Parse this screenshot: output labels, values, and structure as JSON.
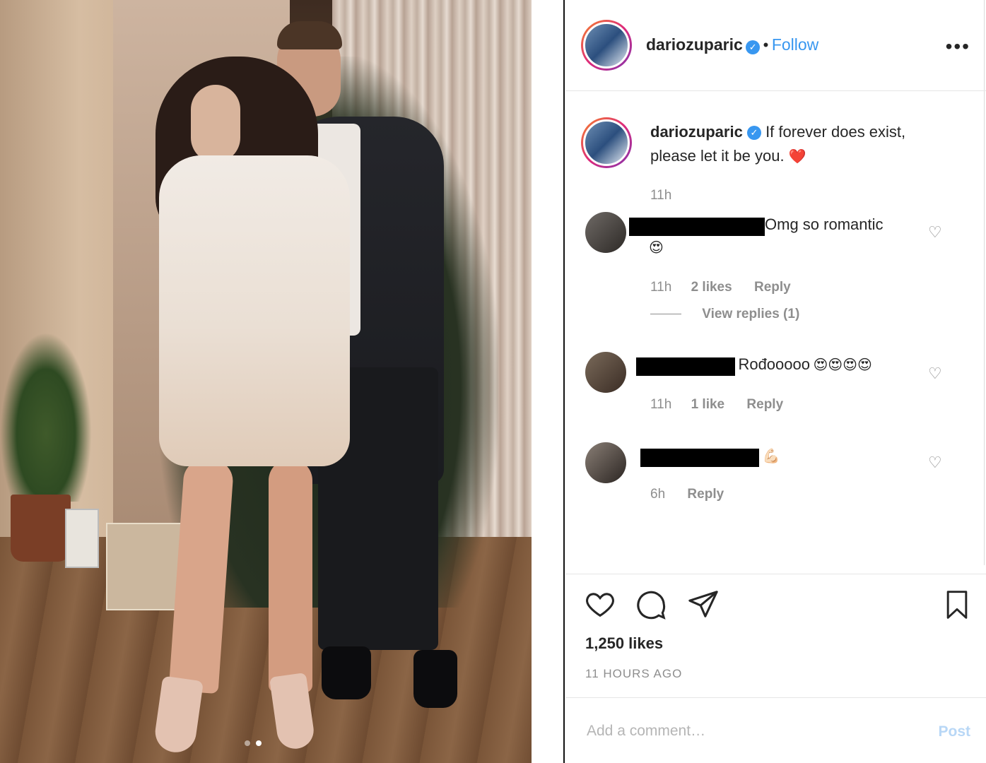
{
  "post": {
    "author": "dariozuparic",
    "follow_label": "Follow",
    "separator": "•",
    "more_label": "•••",
    "caption": "If forever does exist, please let it be you.",
    "caption_emoji": "❤️",
    "caption_time": "11h",
    "carousel": {
      "count": 2,
      "active": 2
    }
  },
  "comments": [
    {
      "text": "Omg so romantic",
      "emoji": "😍",
      "time": "11h",
      "likes": "2 likes",
      "reply_label": "Reply",
      "view_replies": "View replies (1)"
    },
    {
      "text": "Rođooooo",
      "emoji": "😍😍😍😍",
      "time": "11h",
      "likes": "1 like",
      "reply_label": "Reply"
    },
    {
      "text": "",
      "emoji": "💪🏻",
      "time": "6h",
      "reply_label": "Reply"
    }
  ],
  "footer": {
    "likes": "1,250 likes",
    "time_ago": "11 HOURS AGO",
    "comment_placeholder": "Add a comment…",
    "post_label": "Post"
  },
  "icons": {
    "verified": "verified-badge-icon",
    "like": "heart-icon",
    "comment": "comment-bubble-icon",
    "share": "paper-plane-icon",
    "save": "bookmark-icon"
  },
  "colors": {
    "link": "#3897f0",
    "muted": "#8e8e8e",
    "text": "#262626"
  }
}
